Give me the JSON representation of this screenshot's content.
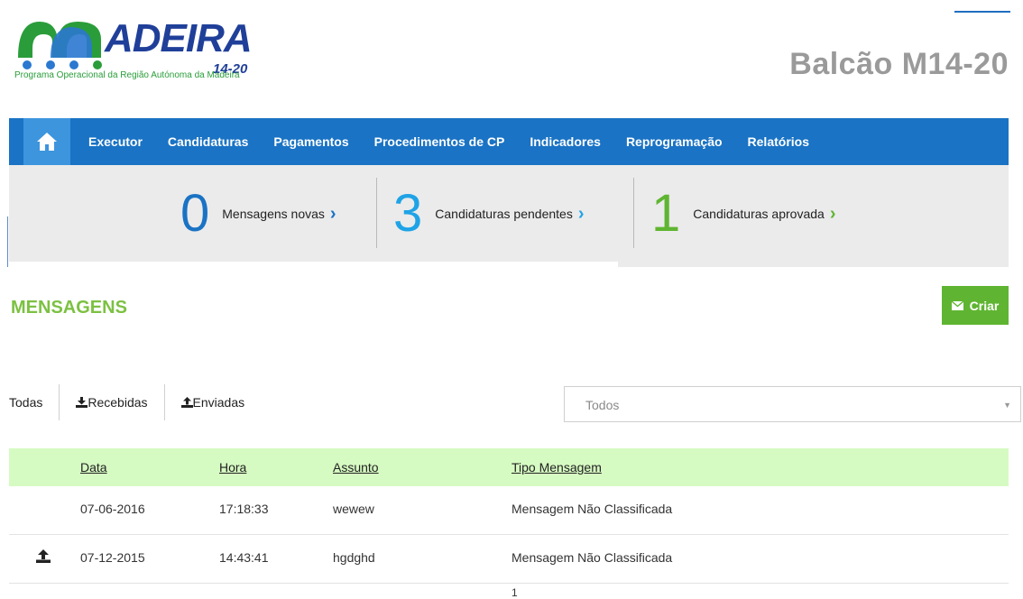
{
  "header": {
    "logo_word": "ADEIRA",
    "logo_period": "14-20",
    "logo_tagline": "Programa Operacional da Região Autónoma da Madeira",
    "portal_title": "Balcão M14-20"
  },
  "nav": {
    "items": [
      "Executor",
      "Candidaturas",
      "Pagamentos",
      "Procedimentos de CP",
      "Indicadores",
      "Reprogramação",
      "Relatórios"
    ]
  },
  "stats": [
    {
      "value": "0",
      "label": "Mensagens novas",
      "color": "#1a73c4"
    },
    {
      "value": "3",
      "label": "Candidaturas pendentes",
      "color": "#1fa3e6"
    },
    {
      "value": "1",
      "label": "Candidaturas aprovada",
      "color": "#5fb531"
    }
  ],
  "section": {
    "title": "MENSAGENS",
    "create_label": "Criar"
  },
  "filters": {
    "tabs": [
      "Todas",
      "Recebidas",
      "Enviadas"
    ],
    "select_value": "Todos"
  },
  "table": {
    "headers": [
      "Data",
      "Hora",
      "Assunto",
      "Tipo Mensagem"
    ],
    "rows": [
      {
        "icon": "",
        "date": "07-06-2016",
        "time": "17:18:33",
        "subject": "wewew",
        "type": "Mensagem Não Classificada"
      },
      {
        "icon": "upload-icon",
        "date": "07-12-2015",
        "time": "14:43:41",
        "subject": "hgdghd",
        "type": "Mensagem Não Classificada"
      }
    ],
    "page": "1"
  },
  "colors": {
    "nav": "#1a73c4",
    "nav_home": "#3d95dd",
    "accent_green": "#5fb531",
    "section_green": "#7cc142",
    "table_header": "#d6fbc2"
  }
}
